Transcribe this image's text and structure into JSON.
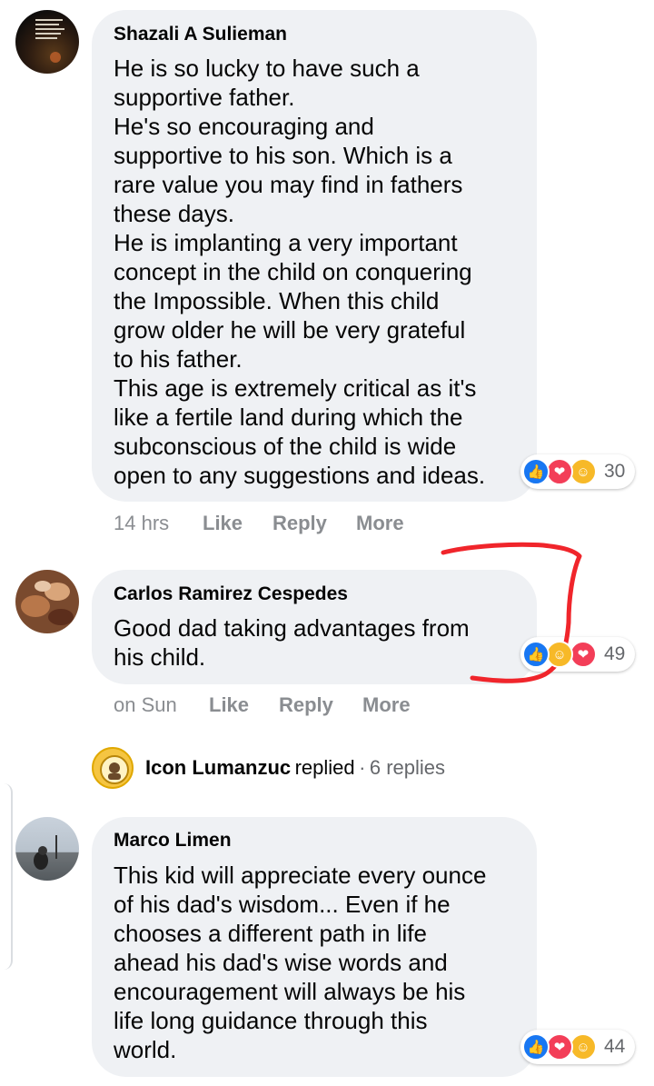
{
  "comments": [
    {
      "author": "Shazali A Sulieman",
      "lines": [
        "He is so lucky to have such a",
        "supportive father.",
        "He's so encouraging and",
        "supportive to his son. Which is a",
        "rare value you may find in fathers",
        "these days.",
        "He is implanting a very important",
        "concept in the child on conquering",
        "the Impossible. When this child",
        "grow older he will be very grateful",
        "to his father.",
        "This age is extremely critical as it's",
        "like a fertile land during which the",
        "subconscious of the child is wide",
        "open to any suggestions and ideas."
      ],
      "time": "14 hrs",
      "reaction_count": "30",
      "reactions": [
        "like",
        "love",
        "care"
      ],
      "avatar_text": "It's always darkest before the dawn. The bigger your challenge, the closer you are to your victory."
    },
    {
      "author": "Carlos Ramirez Cespedes",
      "lines": [
        "Good dad taking advantages from",
        "his child."
      ],
      "time": "on Sun",
      "reaction_count": "49",
      "reactions": [
        "like",
        "haha",
        "love"
      ]
    },
    {
      "author": "Marco Limen",
      "lines": [
        "This kid will appreciate every ounce",
        "of his dad's wisdom... Even if he",
        "chooses a different path in life",
        "ahead his dad's wise words and",
        "encouragement will always be his",
        "life long guidance through this",
        "world."
      ],
      "reaction_count": "44",
      "reactions": [
        "like",
        "love",
        "care"
      ]
    }
  ],
  "actions": {
    "like": "Like",
    "reply": "Reply",
    "more": "More"
  },
  "reply_summary": {
    "name": "Icon Lumanzuc",
    "verb": "replied",
    "separator": "·",
    "count": "6 replies"
  },
  "colors": {
    "bubble": "#eff1f4",
    "like": "#1877f2",
    "love": "#f33e58",
    "care": "#f7b928",
    "annotation": "#f0252b"
  }
}
